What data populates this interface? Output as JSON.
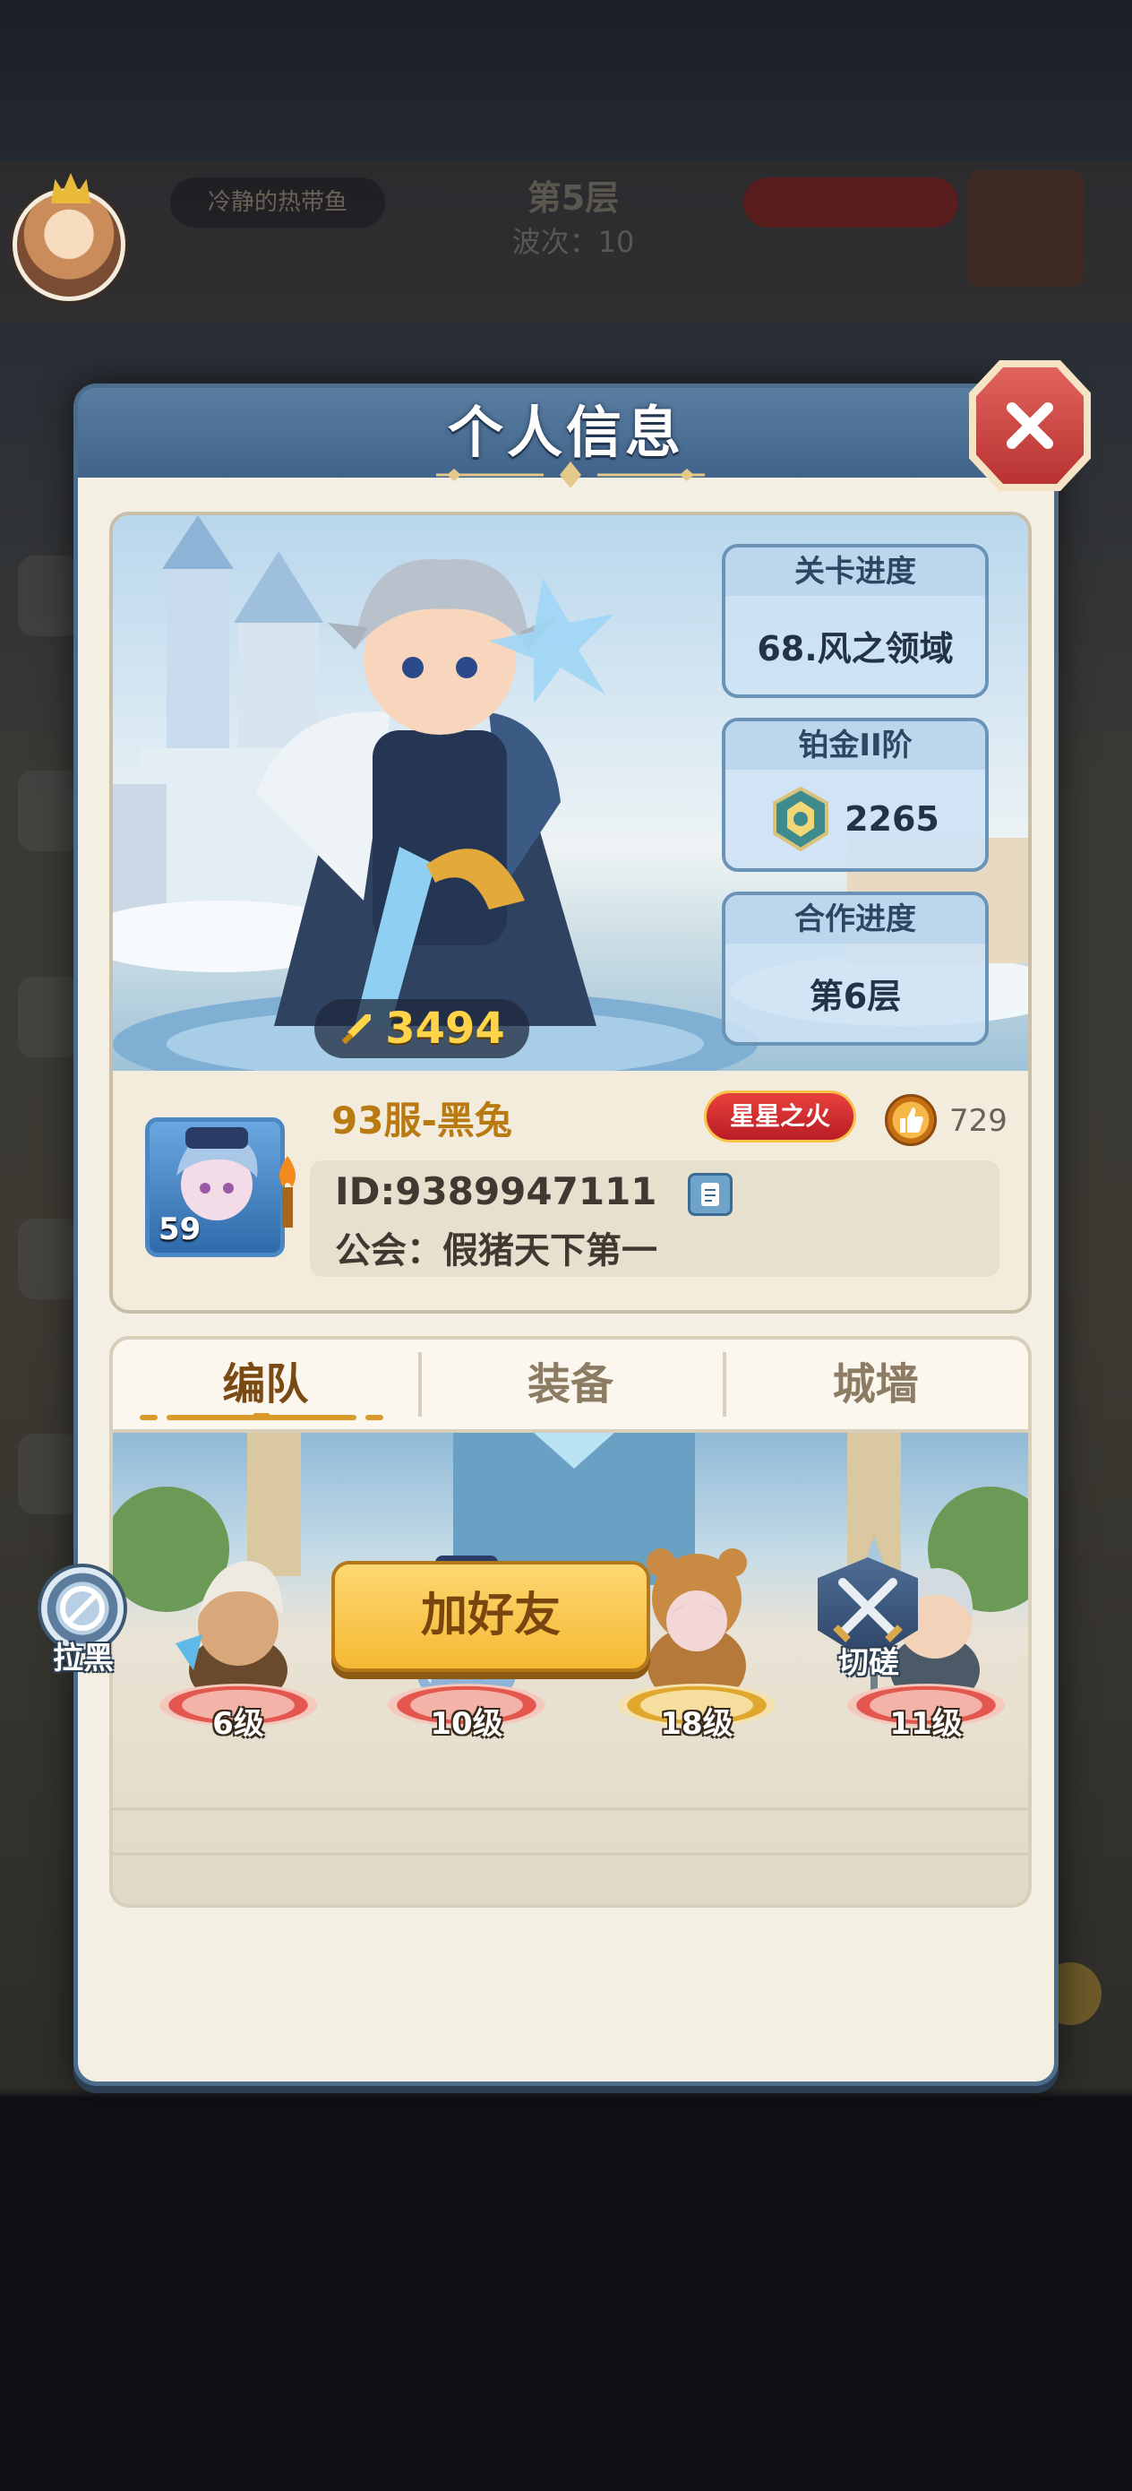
{
  "background": {
    "player_name": "冷静的热带鱼",
    "stage": "第5层",
    "wave": "波次：10"
  },
  "modal": {
    "title": "个人信息",
    "close_icon": "close-icon"
  },
  "hero": {
    "power": "3494",
    "power_icon": "sword-icon"
  },
  "stats": [
    {
      "label": "关卡进度",
      "value": "68.风之领域"
    },
    {
      "label": "铂金II阶",
      "value": "2265",
      "icon": "rank-badge-icon"
    },
    {
      "label": "合作进度",
      "value": "第6层"
    }
  ],
  "player": {
    "level": "59",
    "name": "93服-黑兔",
    "title_badge": "星星之火",
    "likes": "729",
    "id": "ID:9389947111",
    "guild": "公会：假猪天下第一"
  },
  "tabs": [
    {
      "label": "编队",
      "active": true
    },
    {
      "label": "装备",
      "active": false
    },
    {
      "label": "城墙",
      "active": false
    }
  ],
  "team": [
    {
      "level": "6级"
    },
    {
      "level": "10级"
    },
    {
      "level": "18级"
    },
    {
      "level": "11级"
    }
  ],
  "actions": {
    "block": "拉黑",
    "add_friend": "加好友",
    "duel": "切磋"
  },
  "colors": {
    "header_blue": "#41638a",
    "panel_cream": "#f4efe3",
    "gold_button": "#f5b933",
    "close_red": "#b83332",
    "name_gold": "#b97a12"
  }
}
